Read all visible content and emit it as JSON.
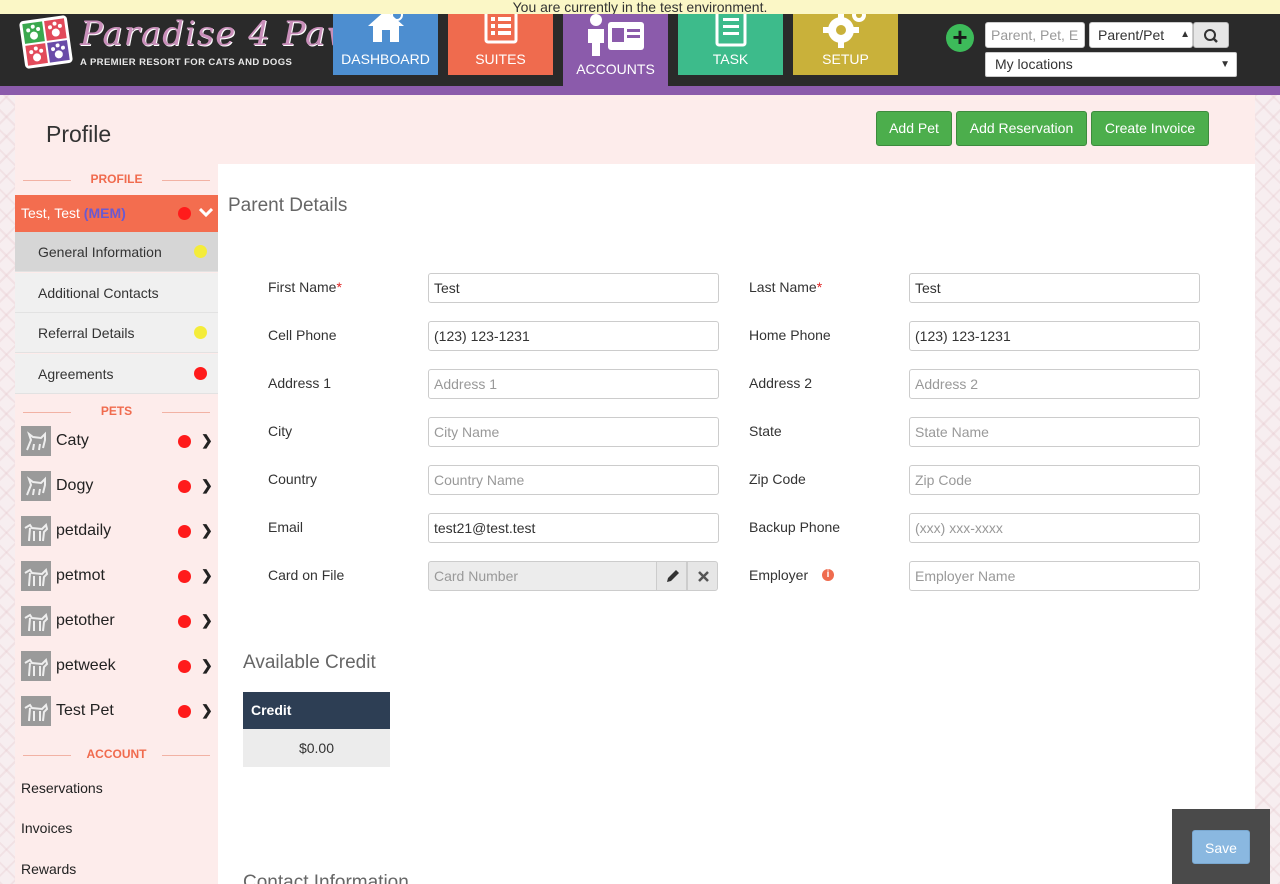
{
  "banner": {
    "text": "You are currently in the test environment."
  },
  "brand": {
    "name": "Paradise 4 Paws",
    "tagline": "A PREMIER RESORT FOR CATS AND DOGS"
  },
  "nav": {
    "tiles": [
      {
        "label": "DASHBOARD",
        "icon": "home-icon",
        "color": "#4d8ed0"
      },
      {
        "label": "SUITES",
        "icon": "list-icon",
        "color": "#ef6b4e"
      },
      {
        "label": "ACCOUNTS",
        "icon": "account-card-icon",
        "color": "#8b5bab",
        "active": true
      },
      {
        "label": "TASK",
        "icon": "clipboard-icon",
        "color": "#3dbb8b"
      },
      {
        "label": "SETUP",
        "icon": "gear-icon",
        "color": "#c9b13a"
      }
    ]
  },
  "search": {
    "placeholder": "Parent, Pet, E",
    "type": "Parent/Pet",
    "location": "My locations"
  },
  "page": {
    "title": "Profile"
  },
  "actions": {
    "add_pet": "Add Pet",
    "add_reservation": "Add Reservation",
    "create_invoice": "Create Invoice"
  },
  "sidebar": {
    "profile_header": "PROFILE",
    "account": {
      "name": "Test, Test",
      "badge": "(MEM)"
    },
    "subitems": [
      {
        "label": "General Information",
        "status": "yellow"
      },
      {
        "label": "Additional Contacts",
        "status": ""
      },
      {
        "label": "Referral Details",
        "status": "yellow"
      },
      {
        "label": "Agreements",
        "status": "red"
      }
    ],
    "pets_header": "PETS",
    "pets": [
      {
        "name": "Caty",
        "type": "cat"
      },
      {
        "name": "Dogy",
        "type": "cat"
      },
      {
        "name": "petdaily",
        "type": "dog"
      },
      {
        "name": "petmot",
        "type": "dog"
      },
      {
        "name": "petother",
        "type": "dog"
      },
      {
        "name": "petweek",
        "type": "dog"
      },
      {
        "name": "Test Pet",
        "type": "dog"
      }
    ],
    "account_header": "ACCOUNT",
    "account_links": [
      "Reservations",
      "Invoices",
      "Rewards"
    ]
  },
  "parent_details": {
    "heading": "Parent Details",
    "fields": {
      "first_name": {
        "label": "First Name",
        "value": "Test",
        "placeholder": ""
      },
      "last_name": {
        "label": "Last Name",
        "value": "Test",
        "placeholder": ""
      },
      "cell_phone": {
        "label": "Cell Phone",
        "value": "(123) 123-1231",
        "placeholder": ""
      },
      "home_phone": {
        "label": "Home Phone",
        "value": "(123) 123-1231",
        "placeholder": ""
      },
      "address1": {
        "label": "Address 1",
        "value": "",
        "placeholder": "Address 1"
      },
      "address2": {
        "label": "Address 2",
        "value": "",
        "placeholder": "Address 2"
      },
      "city": {
        "label": "City",
        "value": "",
        "placeholder": "City Name"
      },
      "state": {
        "label": "State",
        "value": "",
        "placeholder": "State Name"
      },
      "country": {
        "label": "Country",
        "value": "",
        "placeholder": "Country Name"
      },
      "zip": {
        "label": "Zip Code",
        "value": "",
        "placeholder": "Zip Code"
      },
      "email": {
        "label": "Email",
        "value": "test21@test.test",
        "placeholder": ""
      },
      "backup_phone": {
        "label": "Backup Phone",
        "value": "",
        "placeholder": "(xxx) xxx-xxxx"
      },
      "card": {
        "label": "Card on File",
        "value": "",
        "placeholder": "Card Number"
      },
      "employer": {
        "label": "Employer",
        "value": "",
        "placeholder": "Employer Name"
      }
    },
    "required_mark": "*"
  },
  "credit": {
    "heading": "Available Credit",
    "column": "Credit",
    "value": "$0.00"
  },
  "contact": {
    "heading": "Contact Information"
  },
  "save_label": "Save"
}
